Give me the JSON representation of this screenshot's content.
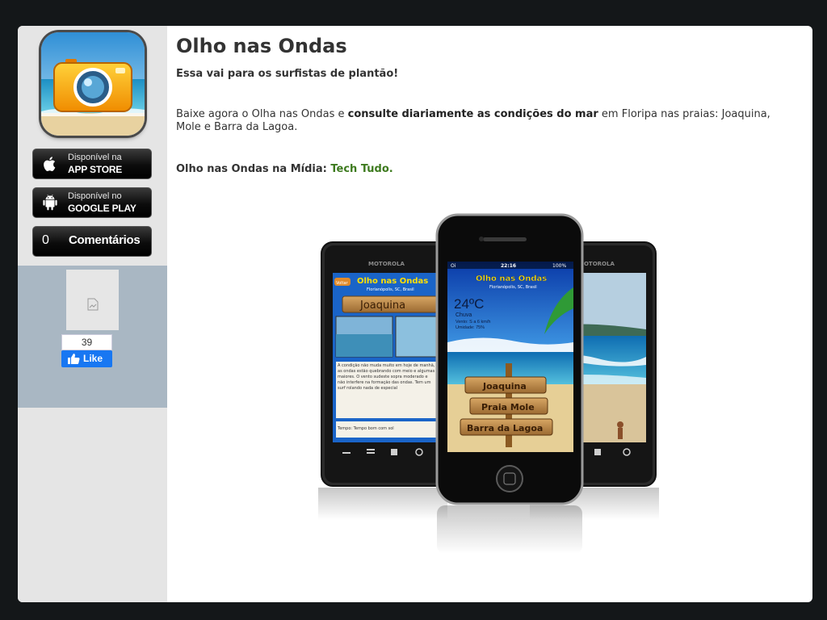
{
  "title": "Olho nas Ondas",
  "subtitle": "Essa vai para os surfistas de plantão!",
  "paragraph": {
    "part1": "Baixe agora o Olha nas Ondas e ",
    "bold": "consulte diariamente as condições do mar",
    "part2": " em Floripa nas praias: Joaquina, Mole e Barra da Lagoa."
  },
  "media": {
    "label": "Olho nas Ondas na Mídia: ",
    "link": "Tech Tudo."
  },
  "sidebar": {
    "app_store": {
      "line1": "Disponível na",
      "line2": "APP STORE"
    },
    "google_play": {
      "line1": "Disponível no",
      "line2": "GOOGLE PLAY"
    },
    "comments": {
      "count": "0",
      "label": "Comentários"
    },
    "like_count": "39",
    "like_label": "Like"
  },
  "phones": {
    "left_brand": "MOTOROLA",
    "right_brand": "MOTOROLA",
    "app_title": "Olho nas Ondas",
    "location": "Florianópolis, SC, Brasil",
    "left_button": "Voltar",
    "left_sign": "Joaquina",
    "left_text": "A condição não muda muito em hoje de manhã, as ondas estão quebrando com meio e algumas maiores. O vento sudeste sopra moderado e não interfere na formação das ondas. Tem um surf rolando nada de especial",
    "left_weather": "Tempo: Tempo bom com sol",
    "carrier": "Oi",
    "clock": "22:16",
    "battery": "100%",
    "temperature": "24ºC",
    "condition": "Chuva",
    "wind": "Vento: S a 6 km/h",
    "humidity": "Umidade: 75%",
    "signs": [
      "Joaquina",
      "Praia Mole",
      "Barra da Lagoa"
    ]
  },
  "colors": {
    "background": "#141719",
    "sidebar": "#e5e5e5",
    "social": "#a9b7c3",
    "link": "#3d7a1e",
    "facebook": "#1877f2"
  }
}
